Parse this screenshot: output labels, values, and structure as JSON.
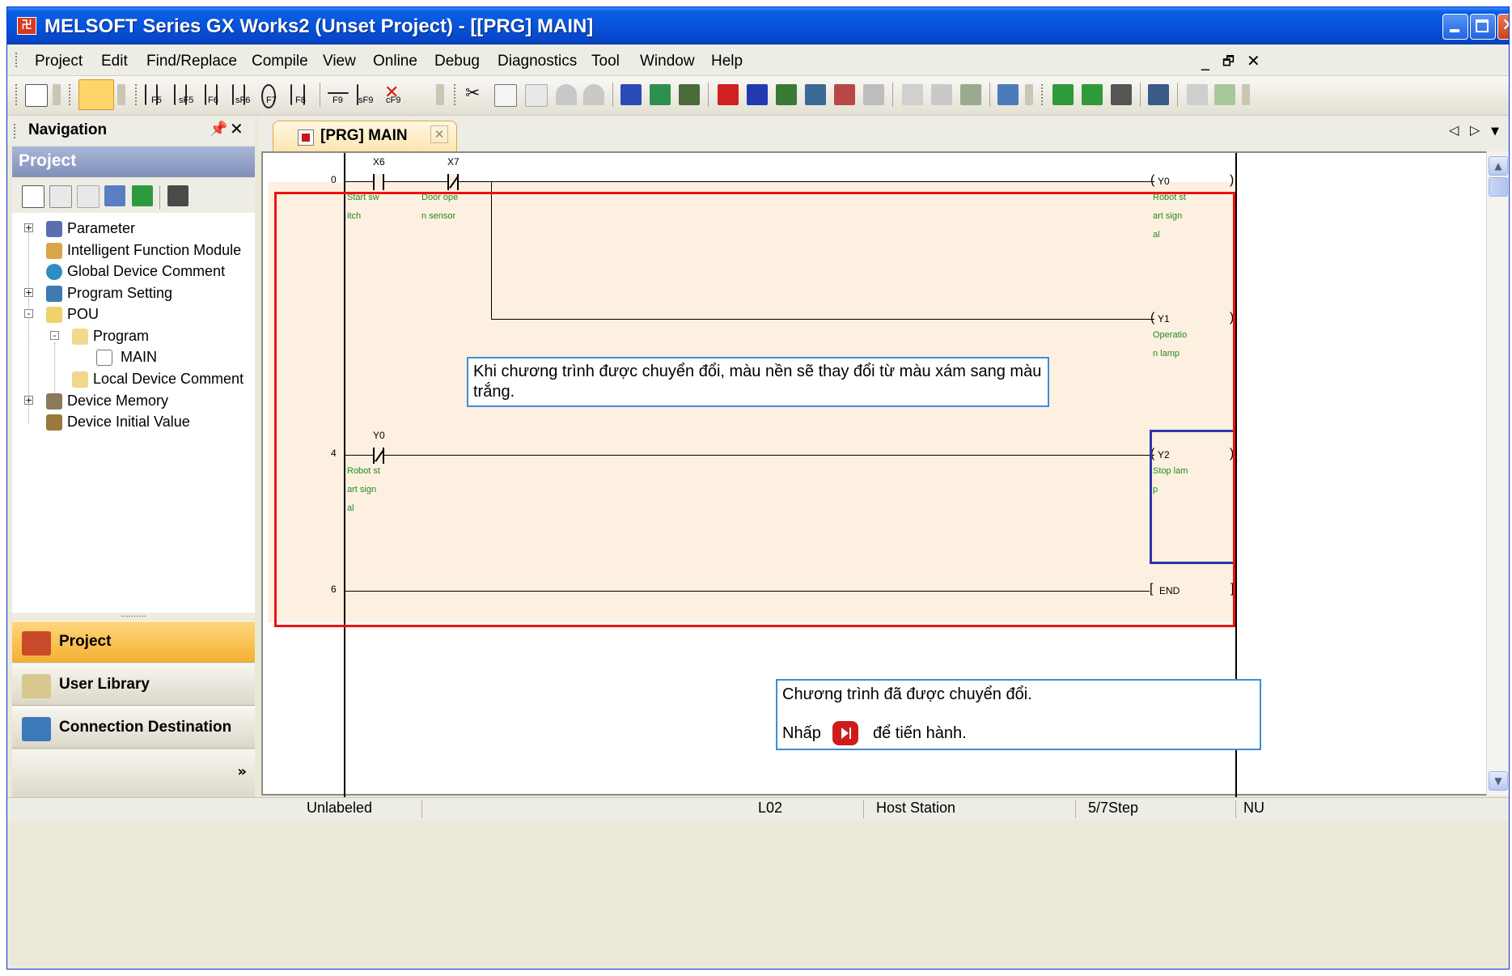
{
  "window": {
    "title": "MELSOFT Series GX Works2 (Unset Project) - [[PRG] MAIN]",
    "app_icon": "melsoft-icon",
    "controls": [
      "minimize",
      "maximize",
      "close"
    ]
  },
  "menu": {
    "items": [
      "Project",
      "Edit",
      "Find/Replace",
      "Compile",
      "View",
      "Online",
      "Debug",
      "Diagnostics",
      "Tool",
      "Window",
      "Help"
    ],
    "mdi_controls": [
      "_",
      "ə",
      "✕"
    ]
  },
  "toolbar": {
    "fkeys": [
      "F5",
      "sF5",
      "F6",
      "sF6",
      "F7",
      "F8",
      "F9",
      "sF9",
      "cF9"
    ]
  },
  "navigation": {
    "header": "Navigation",
    "pin": "ℵ",
    "close": "✕",
    "section": "Project",
    "tree": [
      {
        "label": "Parameter",
        "icon": "parameter-icon",
        "expander": "+"
      },
      {
        "label": "Intelligent Function Module",
        "icon": "module-icon",
        "expander": ""
      },
      {
        "label": "Global Device Comment",
        "icon": "globe-comment-icon",
        "expander": ""
      },
      {
        "label": "Program Setting",
        "icon": "program-setting-icon",
        "expander": "+"
      },
      {
        "label": "POU",
        "icon": "pou-folder-icon",
        "expander": "-"
      },
      {
        "label": "Program",
        "icon": "folder-icon",
        "expander": "-"
      },
      {
        "label": "MAIN",
        "icon": "ladder-program-icon",
        "expander": ""
      },
      {
        "label": "Local Device Comment",
        "icon": "folder-icon",
        "expander": ""
      },
      {
        "label": "Device Memory",
        "icon": "device-memory-icon",
        "expander": "+"
      },
      {
        "label": "Device Initial Value",
        "icon": "device-initial-icon",
        "expander": ""
      }
    ],
    "grip": "..........",
    "buttons": [
      {
        "label": "Project",
        "icon": "project-icon",
        "active": true
      },
      {
        "label": "User Library",
        "icon": "user-library-icon",
        "active": false
      },
      {
        "label": "Connection Destination",
        "icon": "connection-icon",
        "active": false
      }
    ],
    "more": "»"
  },
  "editor": {
    "tab_label": "[PRG] MAIN",
    "tab_close": "✕",
    "tab_nav": [
      "◁",
      "▷",
      "▼"
    ],
    "rungs": [
      {
        "step": "0",
        "contacts": [
          {
            "device": "X6",
            "comment": "Start sw\nitch",
            "type": "NO"
          },
          {
            "device": "X7",
            "comment": "Door ope\nn sensor",
            "type": "NC"
          }
        ],
        "coils": [
          {
            "device": "Y0",
            "comment": "Robot st\nart sign\nal"
          },
          {
            "device": "Y1",
            "comment": "Operatio\nn lamp"
          }
        ]
      },
      {
        "step": "4",
        "contacts": [
          {
            "device": "Y0",
            "comment": "Robot st\nart sign\nal",
            "type": "NC"
          }
        ],
        "coils": [
          {
            "device": "Y2",
            "comment": "Stop lam\np"
          }
        ]
      },
      {
        "step": "6",
        "instruction": "END"
      }
    ],
    "callout_1": "Khi chương trình được chuyển đổi, màu nền sẽ thay đổi từ màu xám sang màu trắng.",
    "callout_2_line1": "Chương trình đã được chuyển đổi.",
    "callout_2_line2a": "Nhấp",
    "callout_2_line2b": "để tiến hành.",
    "highlight_color": "#ee1111",
    "selection_color": "#3333aa",
    "converted_bg": "#fdf0e0"
  },
  "statusbar": {
    "label_status": "Unlabeled",
    "cpu": "L02",
    "station": "Host Station",
    "steps": "5/7Step",
    "numlock": "NU"
  }
}
